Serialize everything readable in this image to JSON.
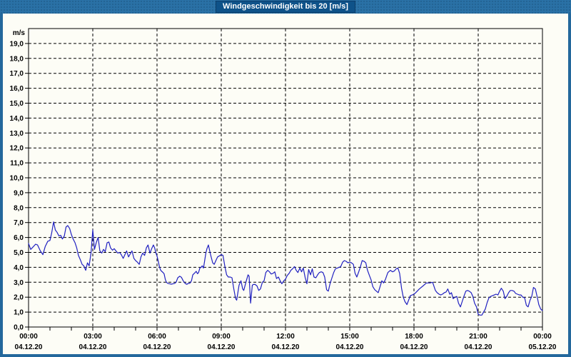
{
  "window": {
    "title": "Windgeschwindigkeit bis 20 [m/s]"
  },
  "colors": {
    "frame": "#24689c",
    "titlebar": "#2a71a6",
    "title_chip_bg": "#0e5289",
    "title_chip_border": "#0b3e6b",
    "title_text": "#ffffff",
    "content_bg": "#fdfdf6",
    "axis": "#000000",
    "grid": "#000000",
    "tick_text": "#000000",
    "series_line": "#2020c0"
  },
  "chart_data": {
    "type": "line",
    "title": "Windgeschwindigkeit bis 20 [m/s]",
    "ylabel": "m/s",
    "xlabel": "",
    "ylim": [
      0,
      20
    ],
    "xlim_hours": [
      0,
      24
    ],
    "grid": "dashed",
    "legend_position": "none",
    "x_minor_tick_hours": 1,
    "y_tick_labels": [
      "0,0",
      "1,0",
      "2,0",
      "3,0",
      "4,0",
      "5,0",
      "6,0",
      "7,0",
      "8,0",
      "9,0",
      "10,0",
      "11,0",
      "12,0",
      "13,0",
      "14,0",
      "15,0",
      "16,0",
      "17,0",
      "18,0",
      "19,0"
    ],
    "x_ticks": [
      {
        "hours": 0,
        "time": "00:00",
        "date": "04.12.20"
      },
      {
        "hours": 3,
        "time": "03:00",
        "date": "04.12.20"
      },
      {
        "hours": 6,
        "time": "06:00",
        "date": "04.12.20"
      },
      {
        "hours": 9,
        "time": "09:00",
        "date": "04.12.20"
      },
      {
        "hours": 12,
        "time": "12:00",
        "date": "04.12.20"
      },
      {
        "hours": 15,
        "time": "15:00",
        "date": "04.12.20"
      },
      {
        "hours": 18,
        "time": "18:00",
        "date": "04.12.20"
      },
      {
        "hours": 21,
        "time": "21:00",
        "date": "04.12.20"
      },
      {
        "hours": 24,
        "time": "00:00",
        "date": "05.12.20"
      }
    ],
    "series": [
      {
        "name": "Windgeschwindigkeit",
        "unit": "m/s",
        "points": [
          [
            0,
            5.6
          ],
          [
            0.1,
            5.2
          ],
          [
            0.2,
            5.35
          ],
          [
            0.33,
            5.55
          ],
          [
            0.42,
            5.5
          ],
          [
            0.55,
            5.1
          ],
          [
            0.67,
            4.85
          ],
          [
            0.78,
            5.4
          ],
          [
            0.9,
            5.75
          ],
          [
            1.0,
            5.8
          ],
          [
            1.08,
            6.3
          ],
          [
            1.17,
            7.05
          ],
          [
            1.25,
            6.5
          ],
          [
            1.33,
            6.35
          ],
          [
            1.42,
            6.1
          ],
          [
            1.5,
            6.15
          ],
          [
            1.58,
            5.9
          ],
          [
            1.67,
            6.1
          ],
          [
            1.75,
            6.7
          ],
          [
            1.83,
            6.8
          ],
          [
            1.92,
            6.6
          ],
          [
            2.0,
            6.2
          ],
          [
            2.08,
            5.9
          ],
          [
            2.17,
            5.65
          ],
          [
            2.25,
            5.3
          ],
          [
            2.33,
            4.8
          ],
          [
            2.42,
            4.5
          ],
          [
            2.5,
            4.2
          ],
          [
            2.58,
            4.1
          ],
          [
            2.67,
            3.8
          ],
          [
            2.75,
            4.3
          ],
          [
            2.83,
            4.1
          ],
          [
            2.92,
            5.0
          ],
          [
            3.0,
            6.5
          ],
          [
            3.08,
            5.2
          ],
          [
            3.17,
            5.7
          ],
          [
            3.25,
            6.0
          ],
          [
            3.33,
            5.1
          ],
          [
            3.42,
            4.95
          ],
          [
            3.5,
            5.2
          ],
          [
            3.58,
            5.05
          ],
          [
            3.67,
            5.65
          ],
          [
            3.75,
            5.7
          ],
          [
            3.83,
            5.3
          ],
          [
            3.92,
            5.15
          ],
          [
            4.0,
            5.25
          ],
          [
            4.08,
            5.1
          ],
          [
            4.17,
            4.95
          ],
          [
            4.25,
            5.0
          ],
          [
            4.33,
            4.85
          ],
          [
            4.42,
            4.6
          ],
          [
            4.5,
            4.85
          ],
          [
            4.58,
            5.1
          ],
          [
            4.67,
            4.7
          ],
          [
            4.75,
            4.9
          ],
          [
            4.83,
            5.1
          ],
          [
            4.92,
            4.6
          ],
          [
            5.0,
            4.45
          ],
          [
            5.08,
            4.35
          ],
          [
            5.17,
            4.2
          ],
          [
            5.25,
            4.7
          ],
          [
            5.33,
            4.95
          ],
          [
            5.42,
            4.8
          ],
          [
            5.5,
            5.3
          ],
          [
            5.58,
            5.5
          ],
          [
            5.67,
            4.95
          ],
          [
            5.75,
            5.25
          ],
          [
            5.83,
            5.5
          ],
          [
            5.89,
            5.3
          ],
          [
            5.94,
            5.0
          ],
          [
            6.0,
            4.75
          ],
          [
            6.06,
            4.4
          ],
          [
            6.11,
            4.05
          ],
          [
            6.17,
            3.8
          ],
          [
            6.22,
            3.73
          ],
          [
            6.28,
            3.65
          ],
          [
            6.33,
            3.57
          ],
          [
            6.39,
            3.17
          ],
          [
            6.44,
            3.0
          ],
          [
            6.5,
            2.93
          ],
          [
            6.58,
            2.9
          ],
          [
            6.67,
            2.87
          ],
          [
            6.75,
            2.9
          ],
          [
            6.83,
            2.93
          ],
          [
            6.89,
            3.0
          ],
          [
            6.97,
            3.3
          ],
          [
            7.06,
            3.4
          ],
          [
            7.14,
            3.33
          ],
          [
            7.22,
            3.1
          ],
          [
            7.31,
            2.93
          ],
          [
            7.39,
            2.86
          ],
          [
            7.47,
            2.93
          ],
          [
            7.53,
            2.93
          ],
          [
            7.61,
            3.1
          ],
          [
            7.67,
            3.5
          ],
          [
            7.72,
            3.57
          ],
          [
            7.78,
            3.65
          ],
          [
            7.83,
            3.73
          ],
          [
            7.89,
            3.57
          ],
          [
            7.94,
            3.65
          ],
          [
            8.0,
            3.95
          ],
          [
            8.06,
            4.0
          ],
          [
            8.11,
            4.1
          ],
          [
            8.17,
            3.95
          ],
          [
            8.22,
            4.4
          ],
          [
            8.28,
            4.95
          ],
          [
            8.33,
            5.25
          ],
          [
            8.4,
            5.5
          ],
          [
            8.5,
            4.85
          ],
          [
            8.6,
            4.3
          ],
          [
            8.67,
            4.2
          ],
          [
            8.78,
            4.55
          ],
          [
            8.83,
            4.7
          ],
          [
            8.95,
            4.8
          ],
          [
            9.0,
            4.85
          ],
          [
            9.08,
            4.8
          ],
          [
            9.17,
            4.05
          ],
          [
            9.25,
            3.5
          ],
          [
            9.33,
            3.35
          ],
          [
            9.42,
            3.35
          ],
          [
            9.5,
            3.3
          ],
          [
            9.58,
            2.6
          ],
          [
            9.67,
            1.9
          ],
          [
            9.72,
            1.8
          ],
          [
            9.83,
            2.8
          ],
          [
            9.92,
            3.1
          ],
          [
            10.0,
            2.55
          ],
          [
            10.05,
            2.45
          ],
          [
            10.17,
            3.1
          ],
          [
            10.25,
            3.5
          ],
          [
            10.3,
            3.4
          ],
          [
            10.37,
            1.6
          ],
          [
            10.45,
            2.8
          ],
          [
            10.5,
            2.85
          ],
          [
            10.58,
            2.85
          ],
          [
            10.67,
            2.75
          ],
          [
            10.75,
            2.45
          ],
          [
            10.83,
            2.55
          ],
          [
            10.92,
            3.0
          ],
          [
            11.0,
            3.1
          ],
          [
            11.08,
            3.65
          ],
          [
            11.17,
            3.8
          ],
          [
            11.25,
            3.7
          ],
          [
            11.33,
            3.55
          ],
          [
            11.42,
            3.6
          ],
          [
            11.5,
            3.7
          ],
          [
            11.58,
            3.25
          ],
          [
            11.67,
            3.35
          ],
          [
            11.75,
            3.1
          ],
          [
            11.83,
            2.9
          ],
          [
            11.92,
            3.1
          ],
          [
            12.0,
            3.2
          ],
          [
            12.08,
            3.45
          ],
          [
            12.17,
            3.6
          ],
          [
            12.25,
            3.8
          ],
          [
            12.33,
            3.9
          ],
          [
            12.42,
            4.05
          ],
          [
            12.5,
            3.8
          ],
          [
            12.58,
            3.65
          ],
          [
            12.67,
            3.95
          ],
          [
            12.75,
            3.7
          ],
          [
            12.83,
            3.95
          ],
          [
            12.92,
            3.3
          ],
          [
            13.0,
            2.9
          ],
          [
            13.08,
            3.85
          ],
          [
            13.17,
            3.5
          ],
          [
            13.25,
            3.9
          ],
          [
            13.33,
            3.35
          ],
          [
            13.42,
            3.3
          ],
          [
            13.5,
            3.5
          ],
          [
            13.58,
            3.65
          ],
          [
            13.67,
            3.7
          ],
          [
            13.75,
            3.65
          ],
          [
            13.83,
            3.35
          ],
          [
            13.92,
            2.5
          ],
          [
            14.0,
            2.4
          ],
          [
            14.08,
            2.9
          ],
          [
            14.17,
            3.3
          ],
          [
            14.25,
            3.65
          ],
          [
            14.33,
            3.9
          ],
          [
            14.42,
            3.95
          ],
          [
            14.5,
            4.0
          ],
          [
            14.58,
            4.05
          ],
          [
            14.67,
            4.35
          ],
          [
            14.75,
            4.45
          ],
          [
            14.83,
            4.4
          ],
          [
            14.92,
            4.3
          ],
          [
            15.0,
            4.35
          ],
          [
            15.08,
            4.3
          ],
          [
            15.17,
            4.2
          ],
          [
            15.25,
            3.6
          ],
          [
            15.33,
            3.35
          ],
          [
            15.42,
            3.7
          ],
          [
            15.5,
            4.05
          ],
          [
            15.58,
            4.45
          ],
          [
            15.67,
            4.4
          ],
          [
            15.75,
            4.3
          ],
          [
            15.83,
            3.8
          ],
          [
            15.92,
            3.45
          ],
          [
            16.0,
            3.15
          ],
          [
            16.08,
            2.7
          ],
          [
            16.17,
            2.5
          ],
          [
            16.33,
            2.3
          ],
          [
            16.5,
            3.1
          ],
          [
            16.58,
            2.95
          ],
          [
            16.67,
            3.2
          ],
          [
            16.78,
            3.65
          ],
          [
            16.9,
            3.8
          ],
          [
            17.0,
            3.7
          ],
          [
            17.08,
            3.75
          ],
          [
            17.17,
            3.9
          ],
          [
            17.25,
            3.95
          ],
          [
            17.33,
            3.6
          ],
          [
            17.42,
            2.6
          ],
          [
            17.5,
            2.0
          ],
          [
            17.58,
            1.7
          ],
          [
            17.67,
            1.5
          ],
          [
            17.75,
            1.8
          ],
          [
            17.83,
            2.1
          ],
          [
            17.92,
            2.15
          ],
          [
            18.0,
            2.2
          ],
          [
            18.08,
            2.3
          ],
          [
            18.25,
            2.55
          ],
          [
            18.42,
            2.75
          ],
          [
            18.58,
            2.95
          ],
          [
            18.75,
            2.95
          ],
          [
            18.87,
            3.0
          ],
          [
            19.0,
            2.45
          ],
          [
            19.08,
            2.3
          ],
          [
            19.17,
            2.2
          ],
          [
            19.25,
            2.15
          ],
          [
            19.33,
            2.2
          ],
          [
            19.42,
            2.3
          ],
          [
            19.5,
            2.35
          ],
          [
            19.58,
            2.55
          ],
          [
            19.67,
            2.2
          ],
          [
            19.75,
            2.3
          ],
          [
            19.83,
            1.9
          ],
          [
            19.92,
            2.0
          ],
          [
            20.0,
            2.05
          ],
          [
            20.08,
            1.6
          ],
          [
            20.17,
            1.35
          ],
          [
            20.25,
            1.7
          ],
          [
            20.33,
            2.05
          ],
          [
            20.42,
            2.4
          ],
          [
            20.5,
            2.45
          ],
          [
            20.58,
            2.4
          ],
          [
            20.67,
            2.3
          ],
          [
            20.75,
            2.05
          ],
          [
            20.83,
            1.6
          ],
          [
            20.92,
            1.35
          ],
          [
            21.0,
            0.85
          ],
          [
            21.08,
            0.8
          ],
          [
            21.17,
            0.8
          ],
          [
            21.25,
            1.0
          ],
          [
            21.33,
            1.2
          ],
          [
            21.42,
            1.65
          ],
          [
            21.5,
            1.95
          ],
          [
            21.58,
            2.05
          ],
          [
            21.67,
            2.1
          ],
          [
            21.75,
            2.15
          ],
          [
            21.83,
            2.2
          ],
          [
            21.92,
            2.15
          ],
          [
            22.0,
            2.4
          ],
          [
            22.08,
            2.6
          ],
          [
            22.17,
            2.4
          ],
          [
            22.25,
            1.9
          ],
          [
            22.33,
            2.05
          ],
          [
            22.42,
            2.3
          ],
          [
            22.5,
            2.45
          ],
          [
            22.58,
            2.45
          ],
          [
            22.67,
            2.4
          ],
          [
            22.75,
            2.25
          ],
          [
            22.83,
            2.2
          ],
          [
            22.92,
            2.15
          ],
          [
            23.0,
            2.15
          ],
          [
            23.08,
            2.0
          ],
          [
            23.17,
            1.95
          ],
          [
            23.25,
            1.45
          ],
          [
            23.33,
            1.35
          ],
          [
            23.42,
            1.8
          ],
          [
            23.5,
            2.05
          ],
          [
            23.58,
            2.65
          ],
          [
            23.67,
            2.55
          ],
          [
            23.75,
            2.05
          ],
          [
            23.83,
            1.5
          ],
          [
            23.92,
            1.2
          ],
          [
            24.0,
            1.1
          ]
        ]
      }
    ]
  }
}
